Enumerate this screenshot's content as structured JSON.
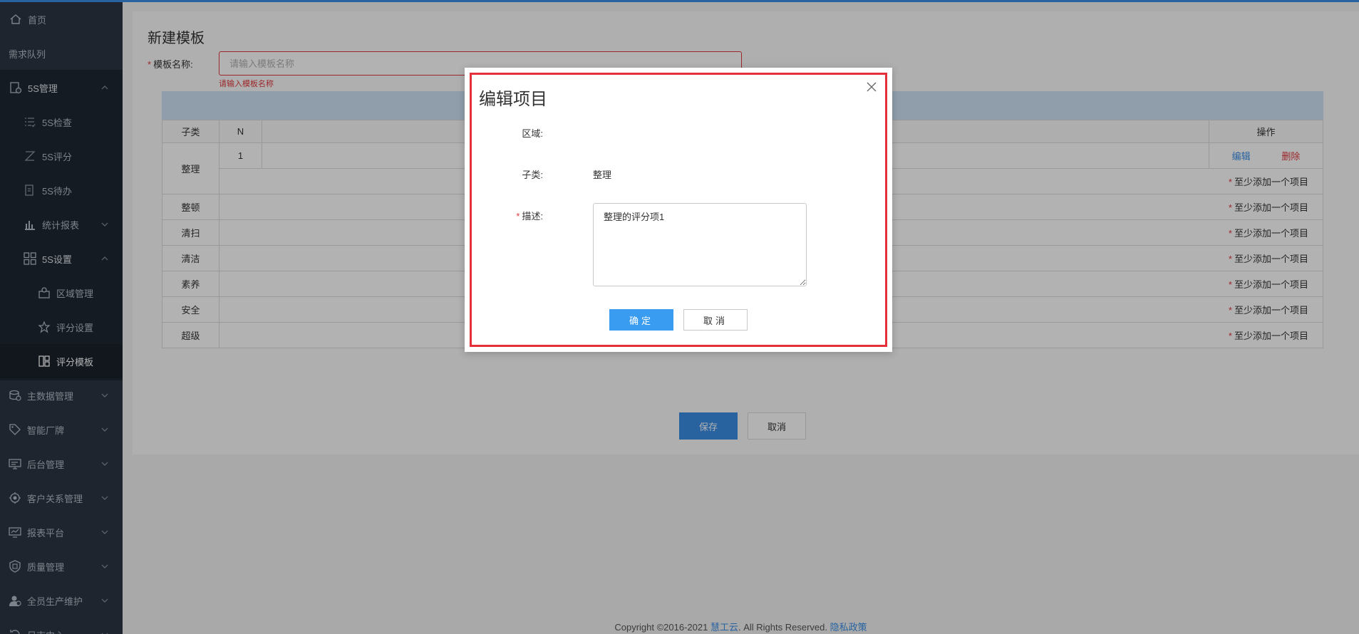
{
  "sidebar": {
    "items": [
      {
        "label": "首页",
        "icon": "home-icon"
      },
      {
        "label": "需求队列"
      },
      {
        "label": "5S管理",
        "icon": "clipboard-clock-icon"
      },
      {
        "label": "5S检查",
        "icon": "list-check-icon"
      },
      {
        "label": "5S评分",
        "icon": "score-icon"
      },
      {
        "label": "5S待办",
        "icon": "todo-icon"
      },
      {
        "label": "统计报表",
        "icon": "bar-chart-icon"
      },
      {
        "label": "5S设置",
        "icon": "grid-icon"
      },
      {
        "label": "区域管理",
        "icon": "area-icon"
      },
      {
        "label": "评分设置",
        "icon": "star-icon"
      },
      {
        "label": "评分模板",
        "icon": "template-icon"
      },
      {
        "label": "主数据管理",
        "icon": "database-icon"
      },
      {
        "label": "智能厂牌",
        "icon": "tag-icon"
      },
      {
        "label": "后台管理",
        "icon": "monitor-icon"
      },
      {
        "label": "客户关系管理",
        "icon": "target-icon"
      },
      {
        "label": "报表平台",
        "icon": "report-icon"
      },
      {
        "label": "质量管理",
        "icon": "shield-icon"
      },
      {
        "label": "全员生产维护",
        "icon": "users-icon"
      },
      {
        "label": "日志中心",
        "icon": "log-icon"
      }
    ]
  },
  "page": {
    "title": "新建模板",
    "name_label": "模板名称:",
    "name_placeholder": "请输入模板名称",
    "name_error": "请输入模板名称",
    "save_label": "保存",
    "cancel_label": "取消"
  },
  "table": {
    "headers": {
      "sub": "子类",
      "n": "N",
      "op": "操作"
    },
    "rows": [
      {
        "sub": "整理",
        "n": "1",
        "edit": "编辑",
        "del": "删除",
        "hint": "至少添加一个项目"
      },
      {
        "sub": "整顿",
        "hint": "至少添加一个项目"
      },
      {
        "sub": "清扫",
        "hint": "至少添加一个项目"
      },
      {
        "sub": "清洁",
        "hint": "至少添加一个项目"
      },
      {
        "sub": "素养",
        "hint": "至少添加一个项目"
      },
      {
        "sub": "安全",
        "hint": "至少添加一个项目"
      },
      {
        "sub": "超级",
        "hint": "至少添加一个项目"
      }
    ]
  },
  "modal": {
    "title": "编辑项目",
    "area_label": "区域:",
    "area_value": "",
    "sub_label": "子类:",
    "sub_value": "整理",
    "desc_label": "描述:",
    "desc_value": "整理的评分项1",
    "ok_label": "确定",
    "cancel_label": "取消"
  },
  "footer": {
    "copyright": "Copyright ©2016-2021",
    "brand": "慧工云",
    "rights": ". All Rights Reserved.",
    "privacy": "隐私政策"
  },
  "colors": {
    "accent": "#3a8ee6",
    "error": "#e0393e",
    "sidebar": "#2b3643",
    "highlight_frame": "#e3303a"
  }
}
